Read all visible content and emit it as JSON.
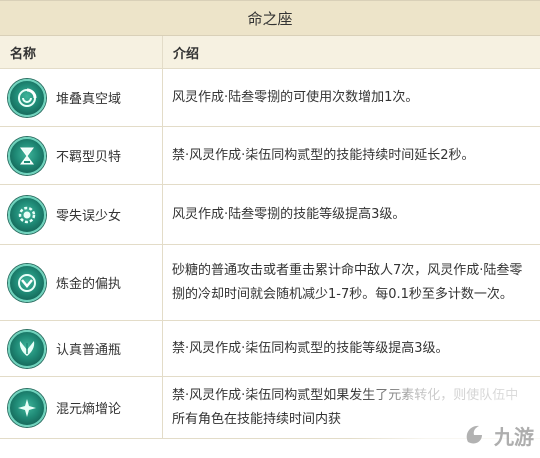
{
  "table": {
    "title": "命之座",
    "col_name": "名称",
    "col_desc": "介绍",
    "rows": [
      {
        "name": "堆叠真空域",
        "icon": "vortex-icon",
        "desc": "风灵作成·陆叁零捌的可使用次数增加1次。"
      },
      {
        "name": "不羁型贝特",
        "icon": "hourglass-icon",
        "desc": "禁·风灵作成·柒伍同构贰型的技能持续时间延长2秒。"
      },
      {
        "name": "零失误少女",
        "icon": "gear-face-icon",
        "desc": "风灵作成·陆叁零捌的技能等级提高3级。"
      },
      {
        "name": "炼金的偏执",
        "icon": "chevron-shield-icon",
        "desc": "砂糖的普通攻击或者重击累计命中敌人7次，风灵作成·陆叁零捌的冷却时间就会随机减少1-7秒。每0.1秒至多计数一次。"
      },
      {
        "name": "认真普通瓶",
        "icon": "wings-icon",
        "desc": "禁·风灵作成·柒伍同构贰型的技能等级提高3级。"
      },
      {
        "name": "混元熵增论",
        "icon": "star-burst-icon",
        "desc": "禁·风灵作成·柒伍同构贰型如果发生了元素转化，则使队伍中所有角色在技能持续时间内获"
      }
    ]
  },
  "watermark": {
    "text": "九游",
    "icon": "jiuyou-logo-icon"
  },
  "colors": {
    "header_bg": "#ede4c9",
    "subheader_bg": "#f6f1e1",
    "border": "#e3dcc8",
    "icon_teal": "#1f8a76"
  }
}
